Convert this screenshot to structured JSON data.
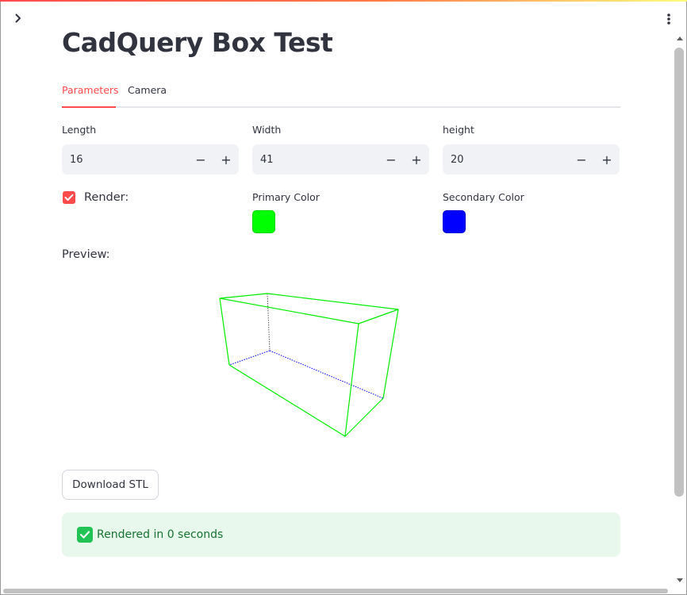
{
  "app": {
    "title": "CadQuery Box Test"
  },
  "tabs": [
    {
      "label": "Parameters",
      "active": true
    },
    {
      "label": "Camera",
      "active": false
    }
  ],
  "params": {
    "length": {
      "label": "Length",
      "value": "16"
    },
    "width": {
      "label": "Width",
      "value": "41"
    },
    "height": {
      "label": "height",
      "value": "20"
    },
    "minus_glyph": "−",
    "plus_glyph": "+"
  },
  "render": {
    "label": "Render:",
    "checked": true
  },
  "colors": {
    "primary": {
      "label": "Primary Color",
      "value": "#00ff00"
    },
    "secondary": {
      "label": "Secondary Color",
      "value": "#0000ff"
    }
  },
  "preview": {
    "label": "Preview:"
  },
  "download": {
    "label": "Download STL"
  },
  "status": {
    "text": "Rendered in 0 seconds"
  },
  "theme": {
    "accent": "#ff4b4b",
    "input_bg": "#f0f2f6",
    "success_bg": "#e8f8ec",
    "success_text": "#177233"
  },
  "icons": {
    "sidebar_toggle": "chevron-right-icon",
    "menu": "vertical-dots-icon",
    "checkbox": "checkmark-icon",
    "status": "checkmark-square-icon"
  }
}
